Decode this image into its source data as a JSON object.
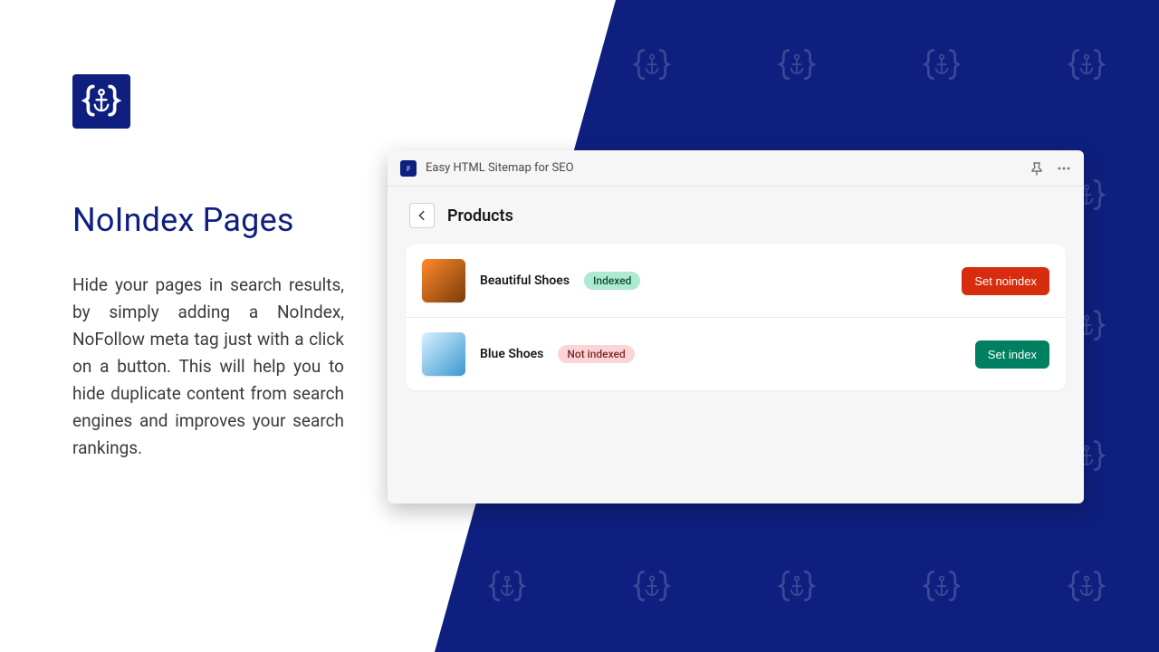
{
  "marketing": {
    "heading": "NoIndex Pages",
    "description": "Hide your pages in search results, by simply adding a NoIndex, NoFollow meta tag just with a click on a button. This will help you to hide duplicate content from search engines and improves your search rankings."
  },
  "app": {
    "title": "Easy HTML Sitemap for SEO",
    "page_title": "Products",
    "products": [
      {
        "name": "Beautiful Shoes",
        "status": "Indexed",
        "status_kind": "indexed",
        "action_label": "Set noindex",
        "action_kind": "red"
      },
      {
        "name": "Blue Shoes",
        "status": "Not indexed",
        "status_kind": "notindexed",
        "action_label": "Set index",
        "action_kind": "green"
      }
    ]
  },
  "colors": {
    "brand": "#0f1f7f",
    "danger": "#d72c0d",
    "success": "#008060"
  }
}
